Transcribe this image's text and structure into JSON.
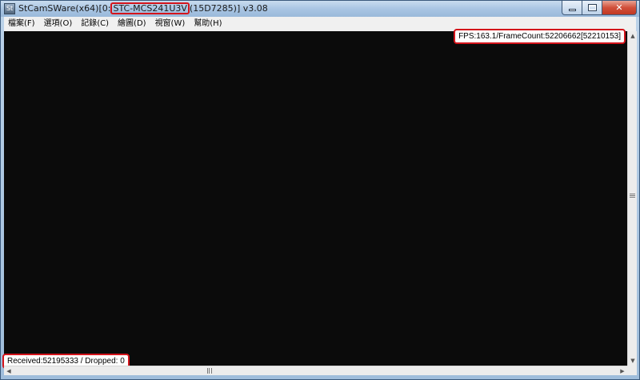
{
  "window": {
    "title_prefix": "StCamSWare(x64)[0:",
    "title_model": "STC-MCS241U3V",
    "title_suffix": "(15D7285)] v3.08",
    "app_icon_label": "St"
  },
  "menu": [
    {
      "label": "檔案(F)"
    },
    {
      "label": "選項(O)"
    },
    {
      "label": "記錄(C)"
    },
    {
      "label": "繪圖(D)"
    },
    {
      "label": "視窗(W)"
    },
    {
      "label": "幫助(H)"
    }
  ],
  "overlay": {
    "fps_text": "FPS:163.1/FrameCount:52206662[52210153]",
    "stats_text": "Received:52195333 / Dropped: 0"
  },
  "colors": {
    "highlight": "#d4141b",
    "viewport_bg": "#0b0b0b"
  },
  "icons": {
    "minimize": "minimize-icon",
    "maximize": "maximize-icon",
    "close": "close-icon"
  }
}
